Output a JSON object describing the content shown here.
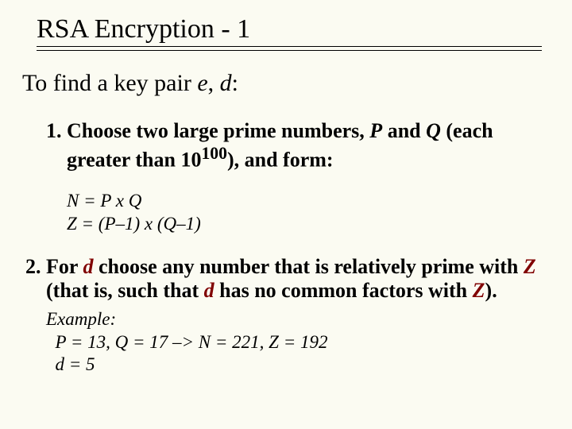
{
  "title": "RSA Encryption - 1",
  "intro_prefix": "To find a key pair ",
  "intro_e": "e",
  "intro_comma": ", ",
  "intro_d": "d",
  "intro_suffix": ":",
  "step1_num": "1.  ",
  "step1_a": "Choose two large prime numbers, ",
  "step1_P": "P",
  "step1_b": " and ",
  "step1_Q": "Q",
  "step1_c": " (each greater than 10",
  "step1_exp": "100",
  "step1_d": "), and form:",
  "formula1": "N = P x Q",
  "formula2": "Z = (P–1) x (Q–1)",
  "step2_num": "2. ",
  "step2_a": "For ",
  "step2_d1": "d",
  "step2_b": " choose any number that is relatively prime with ",
  "step2_Z1": "Z",
  "step2_c": " (that is, such that ",
  "step2_d2": "d",
  "step2_e": " has no common factors with ",
  "step2_Z2": "Z",
  "step2_f": ").",
  "ex_label": "Example:",
  "ex_line1": "  P = 13, Q = 17 –> N = 221, Z = 192",
  "ex_line2": "  d = 5"
}
